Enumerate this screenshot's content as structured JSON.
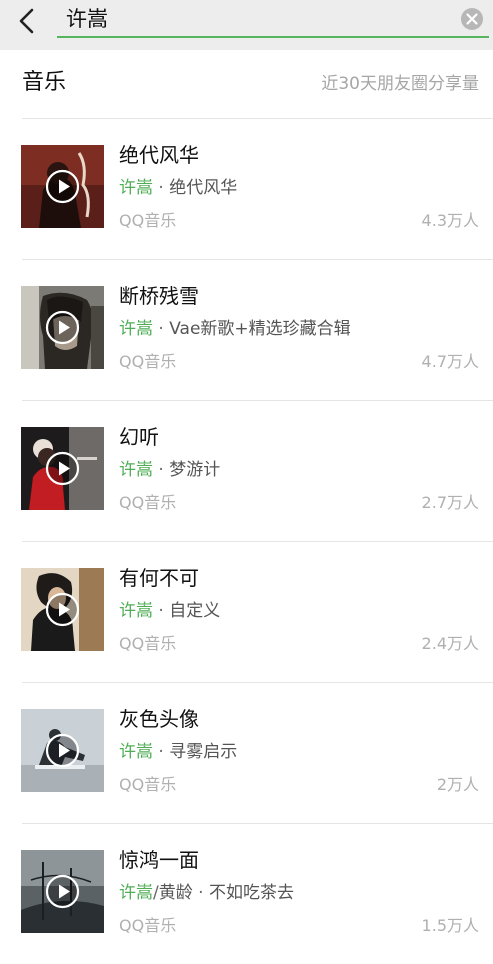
{
  "search": {
    "query": "许嵩"
  },
  "section": {
    "title": "音乐",
    "note": "近30天朋友圈分享量"
  },
  "songs": [
    {
      "title": "绝代风华",
      "artist": "许嵩",
      "album": "绝代风华",
      "source": "QQ音乐",
      "shares": "4.3万人"
    },
    {
      "title": "断桥残雪",
      "artist": "许嵩",
      "album": "Vae新歌+精选珍藏合辑",
      "source": "QQ音乐",
      "shares": "4.7万人"
    },
    {
      "title": "幻听",
      "artist": "许嵩",
      "album": "梦游计",
      "source": "QQ音乐",
      "shares": "2.7万人"
    },
    {
      "title": "有何不可",
      "artist": "许嵩",
      "album": "自定义",
      "source": "QQ音乐",
      "shares": "2.4万人"
    },
    {
      "title": "灰色头像",
      "artist": "许嵩",
      "album": "寻雾启示",
      "source": "QQ音乐",
      "shares": "2万人"
    },
    {
      "title": "惊鸿一面",
      "artist": "许嵩",
      "artist2": "黄龄",
      "album": "不如吃茶去",
      "source": "QQ音乐",
      "shares": "1.5万人"
    }
  ],
  "separator": " · ",
  "slash": "/",
  "colors": {
    "accent": "#4fae55",
    "search_underline": "#58b55f",
    "header_bg": "#ededed",
    "muted_text": "#b0b0b0"
  },
  "icons": {
    "back": "back-arrow-icon",
    "clear": "clear-icon",
    "play": "play-icon"
  }
}
